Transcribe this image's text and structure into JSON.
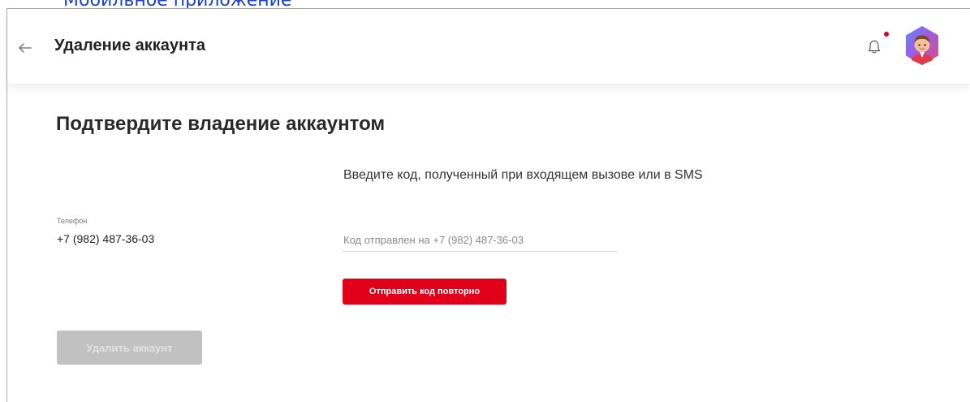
{
  "top_link": {
    "text": "Мобильное приложение"
  },
  "header": {
    "title": "Удаление аккаунта",
    "back_icon": "arrow-left-icon",
    "bell_icon": "bell-icon",
    "has_notification": true,
    "avatar_icon": "avatar-icon"
  },
  "main": {
    "heading": "Подтвердите владение аккаунтом",
    "instruction": "Введите код, полученный при входящем вызове или в SMS",
    "phone": {
      "label": "Телефон",
      "value": "+7 (982) 487-36-03"
    },
    "code_input": {
      "value": "",
      "placeholder": "Код отправлен на +7 (982) 487-36-03"
    },
    "resend_button": "Отправить код повторно",
    "delete_button": "Удалить аккаунт"
  },
  "colors": {
    "accent": "#e0001a",
    "link": "#1a3fd6",
    "disabled_button": "#c1c1c1"
  }
}
